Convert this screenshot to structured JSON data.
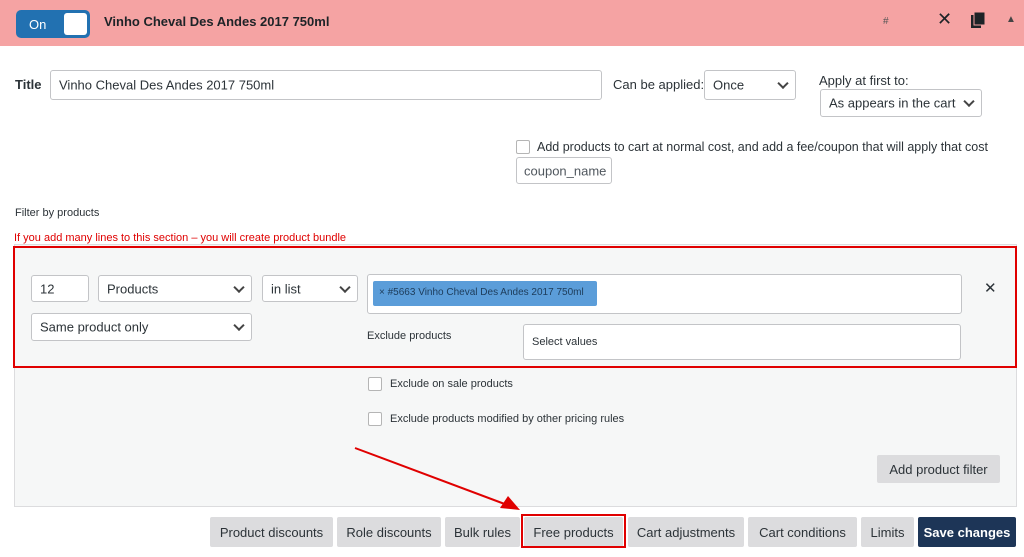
{
  "header": {
    "toggle_label": "On",
    "rule_title": "Vinho Cheval Des Andes 2017 750ml",
    "hash": "#",
    "close_glyph": "✕",
    "collapse_glyph": "▲"
  },
  "form": {
    "title_label": "Title",
    "title_value": "Vinho Cheval Des Andes 2017 750ml",
    "can_be_applied_label": "Can be applied:",
    "can_be_applied_value": "Once",
    "apply_first_label": "Apply at first to:",
    "apply_first_value": "As appears in the cart",
    "fee_coupon_label": "Add products to cart at normal cost, and add a fee/coupon that will apply that cost",
    "coupon_placeholder": "coupon_name"
  },
  "filter": {
    "section_label": "Filter by products",
    "bundle_warning": "If you add many lines to this section – you will create product bundle",
    "qty_value": "12",
    "type_value": "Products",
    "method_value": "in list",
    "selected_tag": "× #5663 Vinho Cheval Des Andes 2017 750ml",
    "remove_glyph": "✕",
    "scope_value": "Same product only",
    "exclude_label": "Exclude products",
    "exclude_placeholder": "Select values",
    "exclude_on_sale": "Exclude on sale products",
    "exclude_modified": "Exclude products modified by other pricing rules",
    "add_filter_button": "Add product filter"
  },
  "tabs": [
    {
      "label": "Product discounts"
    },
    {
      "label": "Role discounts"
    },
    {
      "label": "Bulk rules"
    },
    {
      "label": "Free products"
    },
    {
      "label": "Cart adjustments"
    },
    {
      "label": "Cart conditions"
    },
    {
      "label": "Limits"
    },
    {
      "label": "Save changes"
    }
  ],
  "colors": {
    "header_bg": "#f5a3a3",
    "toggle_bg": "#2271b1",
    "highlight_red": "#e00000",
    "save_bg": "#1d3557"
  }
}
